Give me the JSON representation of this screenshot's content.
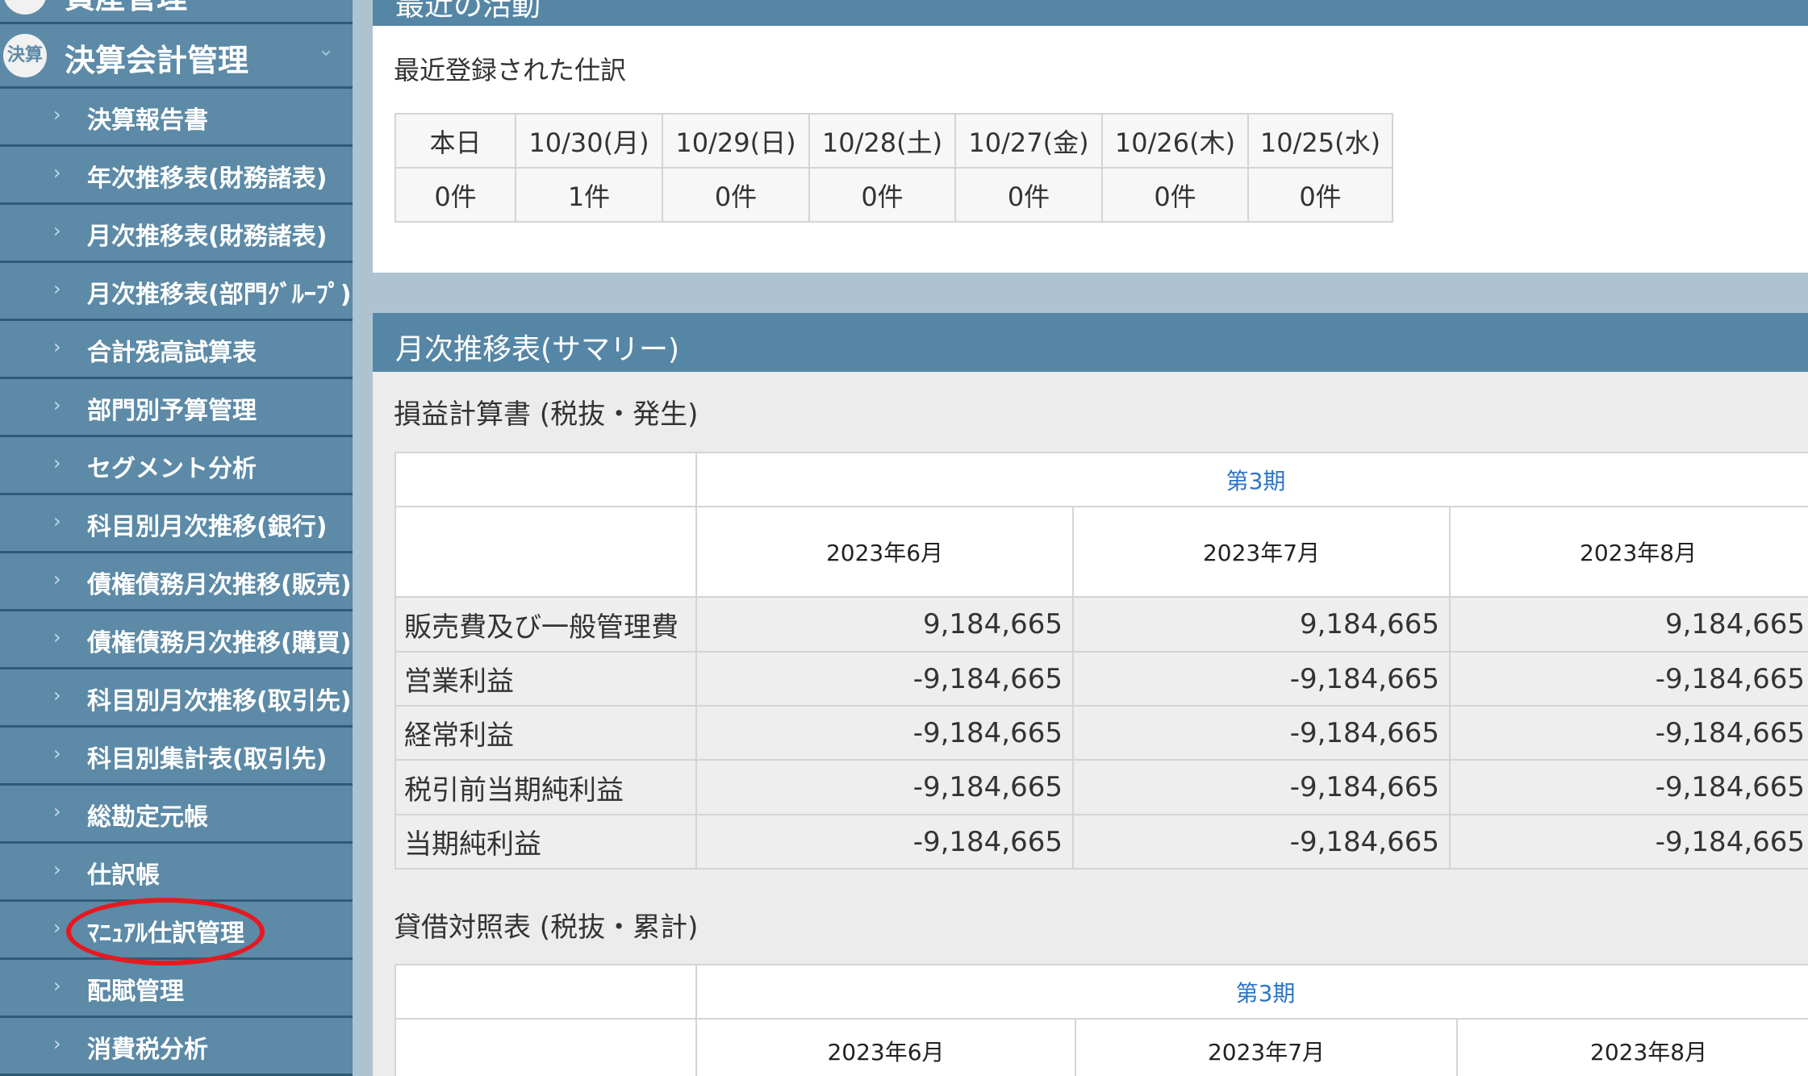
{
  "sidebar": {
    "top_partial_label": "資産管理",
    "parent": {
      "icon_text": "決算",
      "label": "決算会計管理"
    },
    "items": [
      {
        "label": "決算報告書"
      },
      {
        "label": "年次推移表(財務諸表)"
      },
      {
        "label": "月次推移表(財務諸表)"
      },
      {
        "label": "月次推移表(部門ｸﾞﾙｰﾌﾟ)"
      },
      {
        "label": "合計残高試算表"
      },
      {
        "label": "部門別予算管理"
      },
      {
        "label": "セグメント分析"
      },
      {
        "label": "科目別月次推移(銀行)"
      },
      {
        "label": "債権債務月次推移(販売)"
      },
      {
        "label": "債権債務月次推移(購買)"
      },
      {
        "label": "科目別月次推移(取引先)"
      },
      {
        "label": "科目別集計表(取引先)"
      },
      {
        "label": "総勘定元帳"
      },
      {
        "label": "仕訳帳"
      },
      {
        "label": "ﾏﾆｭｱﾙ仕訳管理"
      },
      {
        "label": "配賦管理"
      },
      {
        "label": "消費税分析"
      }
    ],
    "bullet": "›",
    "chevron": "⌄"
  },
  "recent": {
    "header_title": "最近の活動",
    "subtitle": "最近登録された仕訳",
    "headers": [
      "本日",
      "10/30(月)",
      "10/29(日)",
      "10/28(土)",
      "10/27(金)",
      "10/26(木)",
      "10/25(水)"
    ],
    "counts": [
      "0件",
      "1件",
      "0件",
      "0件",
      "0件",
      "0件",
      "0件"
    ]
  },
  "summary": {
    "header_title": "月次推移表(サマリー)",
    "pl": {
      "title": "損益計算書 (税抜・発生)",
      "period": "第3期",
      "months": [
        "2023年6月",
        "2023年7月",
        "2023年8月"
      ],
      "rows": [
        {
          "label": "販売費及び一般管理費",
          "values": [
            "9,184,665",
            "9,184,665",
            "9,184,665"
          ]
        },
        {
          "label": "営業利益",
          "values": [
            "-9,184,665",
            "-9,184,665",
            "-9,184,665"
          ]
        },
        {
          "label": "経常利益",
          "values": [
            "-9,184,665",
            "-9,184,665",
            "-9,184,665"
          ]
        },
        {
          "label": "税引前当期純利益",
          "values": [
            "-9,184,665",
            "-9,184,665",
            "-9,184,665"
          ]
        },
        {
          "label": "当期純利益",
          "values": [
            "-9,184,665",
            "-9,184,665",
            "-9,184,665"
          ]
        }
      ]
    },
    "bs": {
      "title": "貸借対照表 (税抜・累計)",
      "period": "第3期",
      "months": [
        "2023年6月",
        "2023年7月",
        "2023年8月"
      ]
    }
  },
  "colors": {
    "sidebar_bg": "#5c8aa7",
    "header_bg": "#5686a5",
    "link": "#2e74c5",
    "highlight": "#e6191f"
  }
}
